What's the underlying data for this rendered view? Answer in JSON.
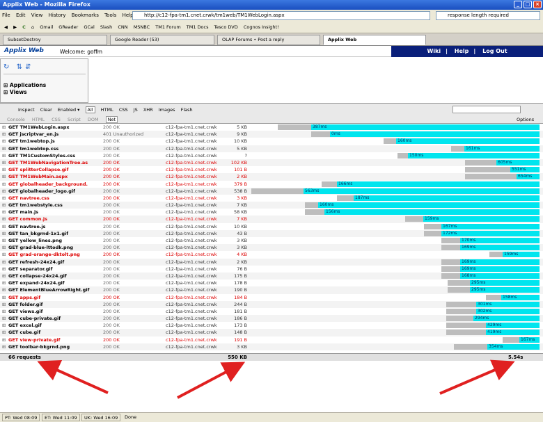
{
  "window": {
    "title": "Applix Web - Mozilla Firefox"
  },
  "menu": [
    "File",
    "Edit",
    "View",
    "History",
    "Bookmarks",
    "Tools",
    "Help"
  ],
  "nav": {
    "url": "http://c12-fpa-tm1.cnet.crwk/tm1web/TM1WebLogin.aspx",
    "search_value": "response length required"
  },
  "bookmarks": [
    "Gmail",
    "GReader",
    "GCal",
    "Slash",
    "CNN",
    "MSNBC",
    "TM1 Forum",
    "TM1 Docs",
    "Tesco DVD",
    "Cognos Insight!"
  ],
  "tabs": [
    {
      "label": "SubsetDestroy"
    },
    {
      "label": "Google Reader (53)"
    },
    {
      "label": "OLAP Forums • Post a reply"
    },
    {
      "label": "Applix Web"
    }
  ],
  "app": {
    "logo": "Applix Web",
    "welcome": "Welcome:",
    "user": "goffm",
    "links": [
      "Wiki",
      "Help",
      "Log Out"
    ],
    "tree": [
      "Applications",
      "Views"
    ]
  },
  "firebug": {
    "toolbar": [
      "Inspect",
      "Clear",
      "Enabled ▾",
      "All",
      "HTML",
      "CSS",
      "JS",
      "XHR",
      "Images",
      "Flash"
    ],
    "panels": [
      "Console",
      "HTML",
      "CSS",
      "Script",
      "DOM",
      "Net"
    ],
    "options": "Options ▾"
  },
  "requests": [
    {
      "name": "GET TM1WebLogin.aspx",
      "status": "200 OK",
      "domain": "c12-fpa-tm1.cnet.crwk",
      "size": "5 KB",
      "time": "387ms",
      "error": false
    },
    {
      "name": "GET jscriptvar_en.js",
      "status": "401 Unauthorized",
      "domain": "c12-fpa-tm1.cnet.crwk",
      "size": "9 KB",
      "time": "0ms",
      "error": false
    },
    {
      "name": "GET tm1webtop.js",
      "status": "200 OK",
      "domain": "c12-fpa-tm1.cnet.crwk",
      "size": "10 KB",
      "time": "160ms",
      "error": false
    },
    {
      "name": "GET tm1webtop.css",
      "status": "200 OK",
      "domain": "c12-fpa-tm1.cnet.crwk",
      "size": "5 KB",
      "time": "161ms",
      "error": false
    },
    {
      "name": "GET TM1CustomStyles.css",
      "status": "200 OK",
      "domain": "c12-fpa-tm1.cnet.crwk",
      "size": "?",
      "time": "150ms",
      "error": false
    },
    {
      "name": "GET TM1WebNavigationTree.as",
      "status": "200 OK",
      "domain": "c12-fpa-tm1.cnet.crwk",
      "size": "102 KB",
      "time": "605ms",
      "error": true
    },
    {
      "name": "GET splitterCollapse.gif",
      "status": "200 OK",
      "domain": "c12-fpa-tm1.cnet.crwk",
      "size": "101 B",
      "time": "551ms",
      "error": true
    },
    {
      "name": "GET TM1WebMain.aspx",
      "status": "200 OK",
      "domain": "c12-fpa-tm1.cnet.crwk",
      "size": "2 KB",
      "time": "654ms",
      "error": true
    },
    {
      "name": "GET globalheader_background.",
      "status": "200 OK",
      "domain": "c12-fpa-tm1.cnet.crwk",
      "size": "379 B",
      "time": "166ms",
      "error": true
    },
    {
      "name": "GET globalheader_logo.gif",
      "status": "200 OK",
      "domain": "c12-fpa-tm1.cnet.crwk",
      "size": "538 B",
      "time": "563ms",
      "error": false
    },
    {
      "name": "GET navtree.css",
      "status": "200 OK",
      "domain": "c12-fpa-tm1.cnet.crwk",
      "size": "3 KB",
      "time": "187ms",
      "error": true
    },
    {
      "name": "GET tm1webstyle.css",
      "status": "200 OK",
      "domain": "c12-fpa-tm1.cnet.crwk",
      "size": "7 KB",
      "time": "160ms",
      "error": false
    },
    {
      "name": "GET main.js",
      "status": "200 OK",
      "domain": "c12-fpa-tm1.cnet.crwk",
      "size": "58 KB",
      "time": "156ms",
      "error": false
    },
    {
      "name": "GET common.js",
      "status": "200 OK",
      "domain": "c12-fpa-tm1.cnet.crwk",
      "size": "7 KB",
      "time": "159ms",
      "error": true
    },
    {
      "name": "GET navtree.js",
      "status": "200 OK",
      "domain": "c12-fpa-tm1.cnet.crwk",
      "size": "10 KB",
      "time": "167ms",
      "error": false
    },
    {
      "name": "GET tan_bkgrnd-1x1.gif",
      "status": "200 OK",
      "domain": "c12-fpa-tm1.cnet.crwk",
      "size": "43 B",
      "time": "172ms",
      "error": false
    },
    {
      "name": "GET yellow_lines.png",
      "status": "200 OK",
      "domain": "c12-fpa-tm1.cnet.crwk",
      "size": "3 KB",
      "time": "170ms",
      "error": false
    },
    {
      "name": "GET grad-blue-lttodk.png",
      "status": "200 OK",
      "domain": "c12-fpa-tm1.cnet.crwk",
      "size": "3 KB",
      "time": "169ms",
      "error": false
    },
    {
      "name": "GET grad-orange-dktolt.png",
      "status": "200 OK",
      "domain": "c12-fpa-tm1.cnet.crwk",
      "size": "4 KB",
      "time": "159ms",
      "error": true
    },
    {
      "name": "GET refresh-24x24.gif",
      "status": "200 OK",
      "domain": "c12-fpa-tm1.cnet.crwk",
      "size": "2 KB",
      "time": "169ms",
      "error": false
    },
    {
      "name": "GET separator.gif",
      "status": "200 OK",
      "domain": "c12-fpa-tm1.cnet.crwk",
      "size": "76 B",
      "time": "169ms",
      "error": false
    },
    {
      "name": "GET collapse-24x24.gif",
      "status": "200 OK",
      "domain": "c12-fpa-tm1.cnet.crwk",
      "size": "175 B",
      "time": "168ms",
      "error": false
    },
    {
      "name": "GET expand-24x24.gif",
      "status": "200 OK",
      "domain": "c12-fpa-tm1.cnet.crwk",
      "size": "178 B",
      "time": "295ms",
      "error": false
    },
    {
      "name": "GET ElementBlueArrowRight.gif",
      "status": "200 OK",
      "domain": "c12-fpa-tm1.cnet.crwk",
      "size": "190 B",
      "time": "295ms",
      "error": false
    },
    {
      "name": "GET apps.gif",
      "status": "200 OK",
      "domain": "c12-fpa-tm1.cnet.crwk",
      "size": "184 B",
      "time": "158ms",
      "error": true
    },
    {
      "name": "GET folder.gif",
      "status": "200 OK",
      "domain": "c12-fpa-tm1.cnet.crwk",
      "size": "244 B",
      "time": "301ms",
      "error": false
    },
    {
      "name": "GET views.gif",
      "status": "200 OK",
      "domain": "c12-fpa-tm1.cnet.crwk",
      "size": "181 B",
      "time": "302ms",
      "error": false
    },
    {
      "name": "GET cube-private.gif",
      "status": "200 OK",
      "domain": "c12-fpa-tm1.cnet.crwk",
      "size": "186 B",
      "time": "294ms",
      "error": false
    },
    {
      "name": "GET excel.gif",
      "status": "200 OK",
      "domain": "c12-fpa-tm1.cnet.crwk",
      "size": "173 B",
      "time": "429ms",
      "error": false
    },
    {
      "name": "GET cube.gif",
      "status": "200 OK",
      "domain": "c12-fpa-tm1.cnet.crwk",
      "size": "148 B",
      "time": "419ms",
      "error": false
    },
    {
      "name": "GET view-private.gif",
      "status": "200 OK",
      "domain": "c12-fpa-tm1.cnet.crwk",
      "size": "191 B",
      "time": "167ms",
      "error": true
    },
    {
      "name": "GET toolbar-bkgrnd.png",
      "status": "200 OK",
      "domain": "c12-fpa-tm1.cnet.crwk",
      "size": "3 KB",
      "time": "354ms",
      "error": false
    }
  ],
  "summary": {
    "requests": "66 requests",
    "size": "550 KB",
    "time": "5.54s"
  },
  "status": {
    "pt": "PT: Wed 08:09",
    "et": "ET: Wed 11:09",
    "uk": "UK: Wed 16:09",
    "text": "Done"
  },
  "colors": {
    "titlebar": "#1a4fc0",
    "app_nav": "#0a1f7a",
    "timeline_receive": "#00e5ee",
    "error_text": "#dd0000",
    "arrow": "#e02020"
  }
}
